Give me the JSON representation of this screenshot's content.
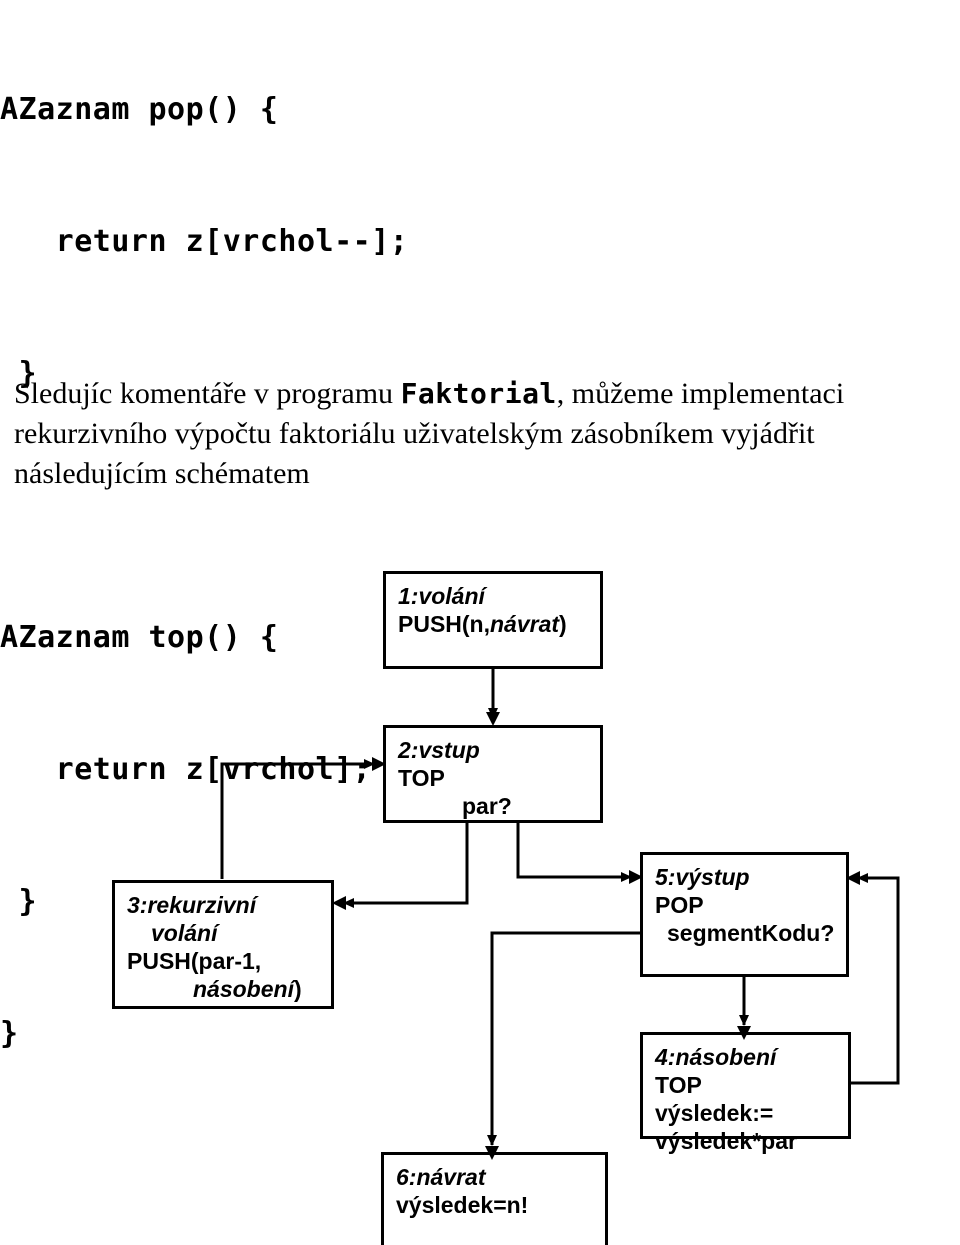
{
  "code": {
    "lines": [
      "AZaznam pop() {",
      "   return z[vrchol--];",
      " }",
      "",
      "AZaznam top() {",
      "   return z[vrchol];",
      " }",
      "}"
    ]
  },
  "paragraph": {
    "before": "Sledujíc komentáře v programu ",
    "mono": "Faktorial",
    "after": ", můžeme implementaci rekurzivního výpočtu faktoriálu uživatelským zásobníkem vyjádřit následujícím schématem"
  },
  "diagram": {
    "nodes": {
      "n1": {
        "header": "1:volání",
        "line2_a": "PUSH(n,",
        "line2_it": "návrat",
        "line2_b": ")"
      },
      "n2": {
        "header": "2:vstup",
        "line2": "TOP",
        "line3": "par?"
      },
      "n3": {
        "header": "3:rekurzivní",
        "header2": "volání",
        "line3": "PUSH(par-1,",
        "line4_it": "násobení",
        "line4_b": ")"
      },
      "n4": {
        "header": "4:násobení",
        "line2": "TOP",
        "line3": "výsledek:=",
        "line4": "výsledek*par"
      },
      "n5": {
        "header": "5:výstup",
        "line2": "POP",
        "line3": "segmentKodu?"
      },
      "n6": {
        "header": "6:návrat",
        "line2": "výsledek=n!"
      }
    },
    "stroke_color": "#000000"
  }
}
